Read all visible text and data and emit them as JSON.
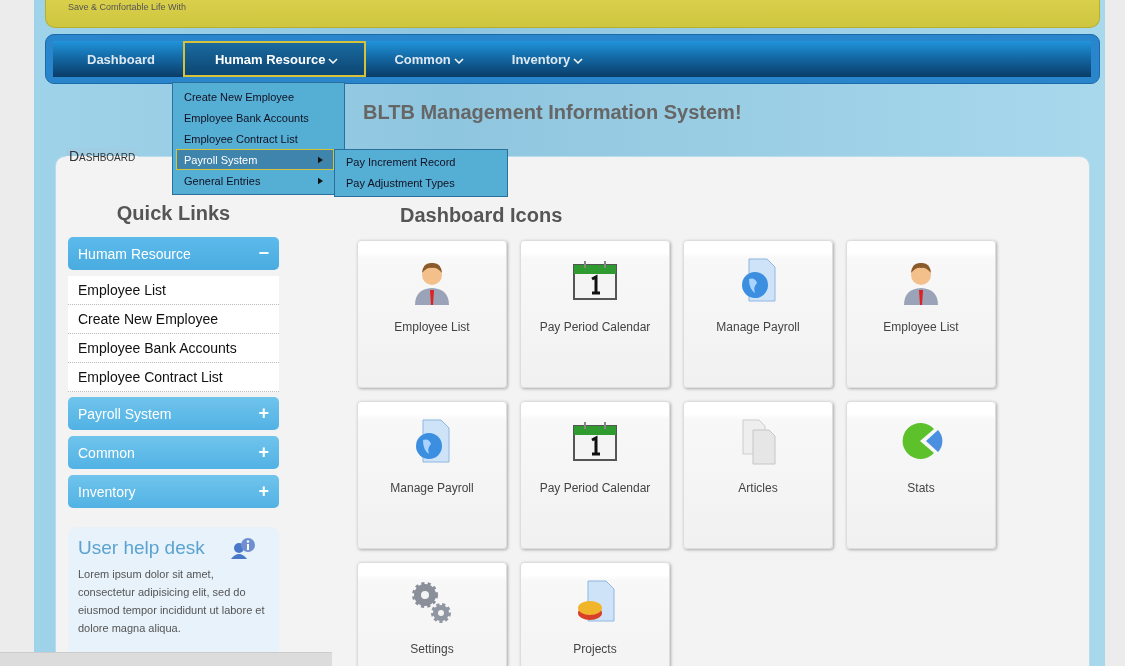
{
  "banner": {
    "text": "Save & Comfortable Life With"
  },
  "nav": [
    {
      "label": "Dashboard",
      "selected": false,
      "has_menu": false
    },
    {
      "label": "Humam Resource",
      "selected": true,
      "has_menu": true
    },
    {
      "label": "Common",
      "selected": false,
      "has_menu": true
    },
    {
      "label": "Inventory",
      "selected": false,
      "has_menu": true
    }
  ],
  "dropdown": [
    {
      "label": "Create New Employee",
      "selected": false,
      "has_submenu": false
    },
    {
      "label": "Employee Bank Accounts",
      "selected": false,
      "has_submenu": false
    },
    {
      "label": "Employee Contract List",
      "selected": false,
      "has_submenu": false
    },
    {
      "label": "Payroll System",
      "selected": true,
      "has_submenu": true,
      "children": [
        {
          "label": "Pay Increment Record"
        },
        {
          "label": "Pay Adjustment Types"
        }
      ]
    },
    {
      "label": "General Entries",
      "selected": false,
      "has_submenu": true
    }
  ],
  "title": "BLTB Management Information System!",
  "panel_legend": "Dashboard",
  "quick_links": {
    "heading": "Quick Links",
    "sections": [
      {
        "title": "Humam Resource",
        "expanded": true,
        "toggle": "−",
        "items": [
          "Employee List",
          "Create New Employee",
          "Employee Bank Accounts",
          "Employee Contract List"
        ]
      },
      {
        "title": "Payroll System",
        "expanded": false,
        "toggle": "+"
      },
      {
        "title": "Common",
        "expanded": false,
        "toggle": "+"
      },
      {
        "title": "Inventory",
        "expanded": false,
        "toggle": "+"
      }
    ]
  },
  "help_desk": {
    "title": "User help desk",
    "text": "Lorem ipsum dolor sit amet, consectetur adipisicing elit, sed do eiusmod tempor incididunt ut labore et dolore magna aliqua."
  },
  "dashboard_icons": {
    "heading": "Dashboard Icons",
    "tiles": [
      {
        "label": "Employee List",
        "kind": "person"
      },
      {
        "label": "Pay Period Calendar",
        "kind": "calendar"
      },
      {
        "label": "Manage Payroll",
        "kind": "globe"
      },
      {
        "label": "Employee List",
        "kind": "person"
      },
      {
        "label": "Manage Payroll",
        "kind": "globe"
      },
      {
        "label": "Pay Period Calendar",
        "kind": "calendar"
      },
      {
        "label": "Articles",
        "kind": "documents"
      },
      {
        "label": "Stats",
        "kind": "pie"
      },
      {
        "label": "Settings",
        "kind": "gears"
      },
      {
        "label": "Projects",
        "kind": "report"
      }
    ]
  }
}
